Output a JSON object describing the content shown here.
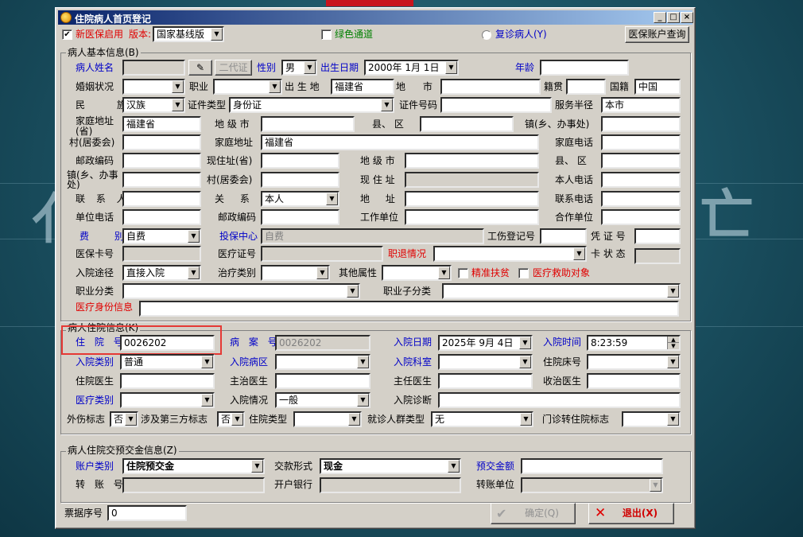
{
  "window": {
    "title": "住院病人首页登记"
  },
  "topbar": {
    "new_insurance_label": "新医保启用",
    "version_label": "版本:",
    "version_value": "国家基线版",
    "green_channel_label": "绿色通道",
    "return_patient_label": "复诊病人(Y)",
    "insurance_query_button": "医保账户查询"
  },
  "basic": {
    "group_title": "病人基本信息(B)",
    "name_label": "病人姓名",
    "id_gen2_button": "二代证",
    "gender_label": "性别",
    "gender_value": "男",
    "birthdate_label": "出生日期",
    "birthdate_value": "2000年 1月 1日",
    "age_label": "年龄",
    "marital_label": "婚姻状况",
    "occupation_label": "职业",
    "birthplace_label": "出 生 地",
    "birthplace_value": "福建省",
    "city_label": "地 市",
    "native_label": "籍贯",
    "nationality_label": "国籍",
    "nationality_value": "中国",
    "ethnicity_label": "民 族",
    "ethnicity_value": "汉族",
    "id_type_label": "证件类型",
    "id_type_value": "身份证",
    "id_number_label": "证件号码",
    "service_radius_label": "服务半径",
    "service_radius_value": "本市",
    "home_address_label": "家庭地址(省)",
    "home_address_value": "福建省",
    "prefecture_label": "地 级 市",
    "county_label": "县、 区",
    "town_label": "镇(乡、办事处)",
    "village_label": "村(居委会)",
    "home_addr2_label": "家庭地址",
    "home_addr2_value": "福建省",
    "home_phone_label": "家庭电话",
    "postcode_label": "邮政编码",
    "current_addr_label": "现住址(省)",
    "prefecture2_label": "地 级 市",
    "county2_label": "县、 区",
    "town2_label": "镇(乡、办事处)",
    "village2_label": "村(居委会)",
    "current_address_label": "现 住 址",
    "own_phone_label": "本人电话",
    "contact_label": "联 系 人",
    "relation_label": "关 系",
    "relation_value": "本人",
    "address_label": "地 址",
    "contact_phone_label": "联系电话",
    "work_phone_label": "单位电话",
    "postcode2_label": "邮政编码",
    "work_unit_label": "工作单位",
    "coop_unit_label": "合作单位",
    "fee_type_label": "费 别",
    "fee_type_value": "自费",
    "insurance_center_label": "投保中心",
    "insurance_center_value": "自费",
    "injury_no_label": "工伤登记号",
    "voucher_label": "凭 证 号",
    "insurance_card_label": "医保卡号",
    "medical_cert_label": "医疗证号",
    "retire_label": "职退情况",
    "card_status_label": "卡 状 态",
    "admission_route_label": "入院途径",
    "admission_route_value": "直接入院",
    "treatment_type_label": "治疗类别",
    "other_attr_label": "其他属性",
    "poverty_label": "精准扶贫",
    "medical_aid_label": "医疗救助对象",
    "job_category_label": "职业分类",
    "job_subcategory_label": "职业子分类",
    "medical_identity_label": "医疗身份信息"
  },
  "admission": {
    "group_title": "病人住院信息(K)",
    "inpatient_no_label": "住 院 号",
    "inpatient_no_value": "0026202",
    "case_no_label": "病 案 号",
    "case_no_value": "0026202",
    "admit_date_label": "入院日期",
    "admit_date_value": "2025年 9月 4日",
    "admit_time_label": "入院时间",
    "admit_time_value": "8:23:59",
    "admit_type_label": "入院类别",
    "admit_type_value": "普通",
    "ward_label": "入院病区",
    "department_label": "入院科室",
    "bed_label": "住院床号",
    "inpatient_doctor_label": "住院医生",
    "attending_label": "主治医生",
    "chief_label": "主任医生",
    "admitting_doctor_label": "收治医生",
    "medical_type_label": "医疗类别",
    "admit_condition_label": "入院情况",
    "admit_condition_value": "一般",
    "admit_diagnosis_label": "入院诊断",
    "trauma_label": "外伤标志",
    "trauma_value": "否",
    "third_party_label": "涉及第三方标志",
    "third_party_value": "否",
    "inpatient_type_label": "住院类型",
    "patient_group_label": "就诊人群类型",
    "patient_group_value": "无",
    "outpatient_transfer_label": "门诊转住院标志"
  },
  "deposit": {
    "group_title": "病人住院交预交金信息(Z)",
    "account_type_label": "账户类别",
    "account_type_value": "住院预交金",
    "payment_form_label": "交款形式",
    "payment_form_value": "现金",
    "deposit_amount_label": "预交金额",
    "transfer_no_label": "转 账 号",
    "bank_label": "开户银行",
    "transfer_unit_label": "转账单位"
  },
  "footer": {
    "receipt_label": "票据序号",
    "receipt_value": "0",
    "confirm_button": "确定(Q)",
    "exit_button": "退出(X)"
  }
}
